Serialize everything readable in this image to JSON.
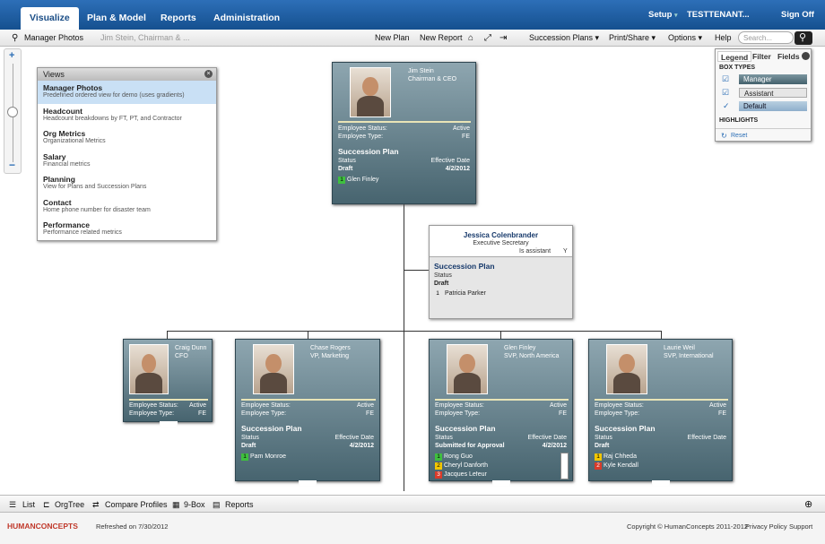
{
  "topnav": {
    "tabs": [
      "Visualize",
      "Plan & Model",
      "Reports",
      "Administration"
    ],
    "setup": "Setup",
    "tenant": "TESTTENANT...",
    "signoff": "Sign Off"
  },
  "toolbar": {
    "manager_photos": "Manager Photos",
    "breadcrumb": "Jim Stein, Chairman & ...",
    "new_plan": "New Plan",
    "new_report": "New Report",
    "succession_plans": "Succession Plans",
    "print_share": "Print/Share",
    "options": "Options",
    "help": "Help",
    "search_placeholder": "Search..."
  },
  "views": {
    "title": "Views",
    "items": [
      {
        "title": "Manager Photos",
        "desc": "Predefined ordered view for demo (uses gradients)"
      },
      {
        "title": "Headcount",
        "desc": "Headcount breakdowns by FT, PT, and Contractor"
      },
      {
        "title": "Org Metrics",
        "desc": "Organizational Metrics"
      },
      {
        "title": "Salary",
        "desc": "Financial metrics"
      },
      {
        "title": "Planning",
        "desc": "View for Plans and Succession Plans"
      },
      {
        "title": "Contact",
        "desc": "Home phone number for disaster team"
      },
      {
        "title": "Performance",
        "desc": "Performance related metrics"
      }
    ]
  },
  "labels": {
    "emp_status": "Employee Status:",
    "emp_type": "Employee Type:",
    "active": "Active",
    "fe": "FE",
    "succession_plan": "Succession Plan",
    "status": "Status",
    "effective_date": "Effective Date"
  },
  "ceo": {
    "name": "Jim Stein",
    "title": "Chairman & CEO",
    "plan_status": "Draft",
    "plan_date": "4/2/2012",
    "successors": [
      {
        "rank": "1",
        "name": "Glen Finley"
      }
    ]
  },
  "assistant": {
    "name": "Jessica Colenbrander",
    "title": "Executive Secretary",
    "is_assistant": "Is assistant",
    "is_assistant_val": "Y",
    "plan_title": "Succession Plan",
    "status": "Status",
    "plan_status": "Draft",
    "successors": [
      {
        "rank": "1",
        "name": "Patricia Parker"
      }
    ]
  },
  "reports": [
    {
      "name": "Craig Dunn",
      "title": "CFO"
    },
    {
      "name": "Chase Rogers",
      "title": "VP, Marketing",
      "plan_status": "Draft",
      "plan_date": "4/2/2012",
      "successors": [
        {
          "rank": "1",
          "name": "Pam Monroe"
        }
      ]
    },
    {
      "name": "Glen Finley",
      "title": "SVP, North America",
      "plan_status": "Submitted for Approval",
      "plan_date": "4/2/2012",
      "successors": [
        {
          "rank": "1",
          "name": "Rong Guo"
        },
        {
          "rank": "2",
          "name": "Cheryl Danforth"
        },
        {
          "rank": "3",
          "name": "Jacques Lefeur"
        }
      ]
    },
    {
      "name": "Laurie Weil",
      "title": "SVP, International",
      "plan_status": "Draft",
      "plan_date": "",
      "successors": [
        {
          "rank": "1",
          "name": "Raj Chheda"
        },
        {
          "rank": "2",
          "name": "Kyle Kendall"
        }
      ]
    }
  ],
  "legend": {
    "tabs": [
      "Legend",
      "Filter",
      "Fields"
    ],
    "box_types": "BOX TYPES",
    "types": [
      "Manager",
      "Assistant",
      "Default"
    ],
    "highlights": "HIGHLIGHTS",
    "reset": "Reset"
  },
  "bottombar": {
    "list": "List",
    "orgtree": "OrgTree",
    "compare": "Compare Profiles",
    "ninebox": "9-Box",
    "reports": "Reports"
  },
  "footer": {
    "brand": "HUMANCONCEPTS",
    "refreshed": "Refreshed on  7/30/2012",
    "copyright": "Copyright © HumanConcepts 2011-2012",
    "privacy": "Privacy Policy",
    "support": "Support"
  },
  "colors": {
    "rank1": "#3fbf3f",
    "rank2": "#f2c600",
    "rank3": "#d93b2b",
    "topnav": "#1f5fa3"
  }
}
